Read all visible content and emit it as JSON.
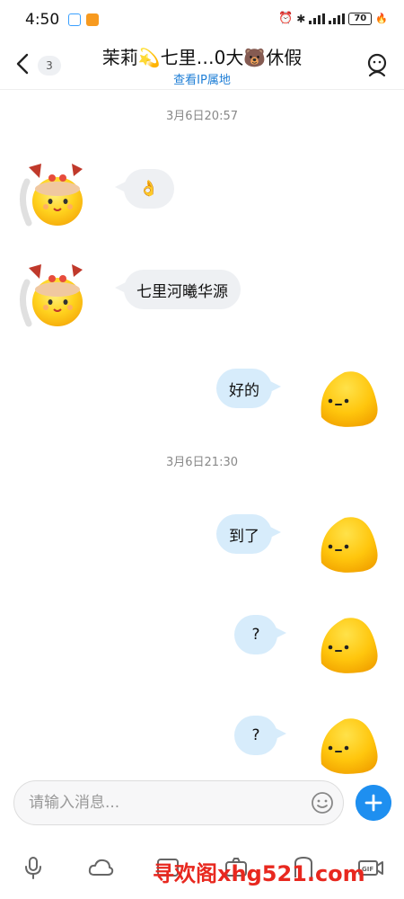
{
  "status_bar": {
    "time": "4:50",
    "battery": "70"
  },
  "header": {
    "title": "茉莉💫七里…0大🐻休假",
    "subtitle": "查看IP属地",
    "unread_count": "3"
  },
  "messages": {
    "divider_1": "3月6日20:57",
    "divider_2": "3月6日21:30",
    "incoming": [
      {
        "text": "👌"
      },
      {
        "text": "七里河曦华源"
      }
    ],
    "outgoing": [
      {
        "text": "好的"
      },
      {
        "text": "到了"
      },
      {
        "text": "?"
      },
      {
        "text": "?"
      }
    ]
  },
  "input": {
    "placeholder": "请输入消息..."
  },
  "toolbar": {
    "items": [
      "mic-icon",
      "cloud-icon",
      "image-icon",
      "camera-icon",
      "redpacket-icon",
      "gif-icon"
    ]
  },
  "watermark": {
    "text": "寻欢阁xhg521.com"
  },
  "colors": {
    "accent": "#1e8ff0",
    "link": "#1e7ed6",
    "outgoing_bubble": "#d7ecfb",
    "incoming_bubble": "#eef0f3",
    "watermark": "#e8281f",
    "avatar_yellow": "#ffc81a"
  }
}
